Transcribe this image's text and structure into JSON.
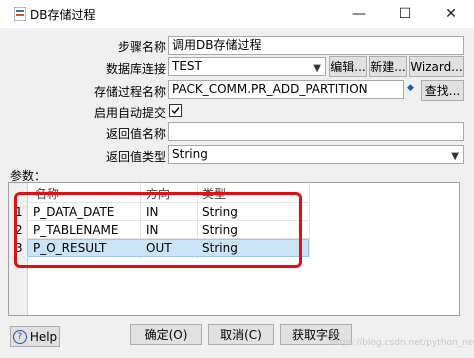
{
  "window": {
    "title": "DB存储过程",
    "minimize_glyph": "—",
    "maximize_glyph": "☐",
    "close_glyph": "✕"
  },
  "form": {
    "step_name_label": "步骤名称",
    "step_name_value": "调用DB存储过程",
    "db_conn_label": "数据库连接",
    "db_conn_value": "TEST",
    "edit_button": "编辑...",
    "new_button": "新建...",
    "wizard_button": "Wizard...",
    "proc_name_label": "存储过程名称",
    "proc_name_value": "PACK_COMM.PR_ADD_PARTITION",
    "find_button": "查找...",
    "autocommit_label": "启用自动提交",
    "autocommit_checked": true,
    "return_name_label": "返回值名称",
    "return_name_value": "",
    "return_type_label": "返回值类型",
    "return_type_value": "String"
  },
  "params": {
    "section_label": "参数：",
    "columns": [
      "名称",
      "方向",
      "类型"
    ],
    "rows": [
      {
        "num": "1",
        "name": "P_DATA_DATE",
        "direction": "IN",
        "type": "String"
      },
      {
        "num": "2",
        "name": "P_TABLENAME",
        "direction": "IN",
        "type": "String"
      },
      {
        "num": "3",
        "name": "P_O_RESULT",
        "direction": "OUT",
        "type": "String"
      }
    ]
  },
  "footer": {
    "help_button": "Help",
    "ok_button": "确定(O)",
    "cancel_button": "取消(C)",
    "get_fields_button": "获取字段"
  },
  "watermark": "https://blog.csdn.net/python_net",
  "colors": {
    "highlight": "#cce4f7",
    "annotation": "#e01010"
  }
}
